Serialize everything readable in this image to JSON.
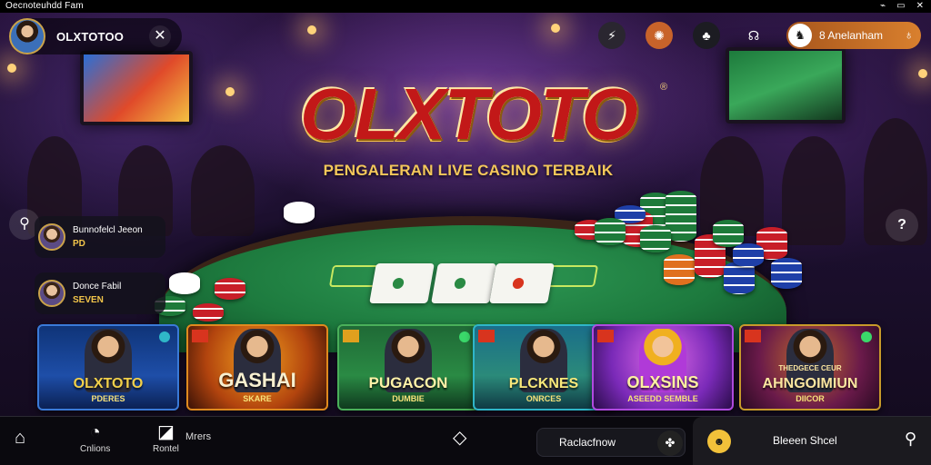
{
  "status_bar": {
    "title": "Oecnoteuhdd Fam",
    "icons": [
      "wifi-icon",
      "battery-icon",
      "close-icon"
    ],
    "icon_glyphs": [
      "⌁",
      "▭",
      "✕"
    ]
  },
  "user": {
    "name": "OLXTOTOO",
    "close_glyph": "✕"
  },
  "top_icons": [
    {
      "name": "sports-icon",
      "glyph": "⚡"
    },
    {
      "name": "settings-icon",
      "glyph": "✺"
    },
    {
      "name": "gift-icon",
      "glyph": "♣"
    },
    {
      "name": "support-icon",
      "glyph": "☊"
    }
  ],
  "balance": {
    "label": "8 Anelanham",
    "icon_glyph": "♞",
    "user_glyph": "♁"
  },
  "hero": {
    "logo": "OLXTOTO",
    "reg": "®",
    "tagline": "PENGALERAN LIVE CASINO TERBAIK"
  },
  "feed": [
    {
      "name": "Bunnofelcl Jeeon",
      "amount": "PD"
    },
    {
      "name": "Donce Fabil",
      "amount": "SEVEN"
    }
  ],
  "games": [
    {
      "title": "OLXTOTO",
      "subtitle": "PDERES"
    },
    {
      "title": "GASHAI",
      "subtitle": "SKARE"
    },
    {
      "title": "PUGACON",
      "subtitle": "DUMBIE"
    },
    {
      "title": "PLCKNES",
      "subtitle": "ONRCES"
    },
    {
      "title": "OLXSINS",
      "subtitle": "ASEEDD SEMBLE"
    },
    {
      "title": "AHNGOIMIUN",
      "subtitle": "DIICOR"
    }
  ],
  "game_headlines": {
    "tile6_top": "THEDGECE CEUR"
  },
  "bottom_nav": {
    "home_glyph": "⌂",
    "options_label": "Cnlions",
    "options_glyph": "◔",
    "notes_label": "Rontel",
    "notes_glyph": "◪",
    "more_label": "Mrers",
    "center_glyph": "◇",
    "search_label": "Raclacfnow",
    "search_glyph": "✤",
    "sheet_label": "Bleeen Shcel",
    "sheet_glyph": "☻",
    "sheet_action_glyph": "⚲"
  },
  "help_glyph": "?",
  "search_glyph": "⚲"
}
